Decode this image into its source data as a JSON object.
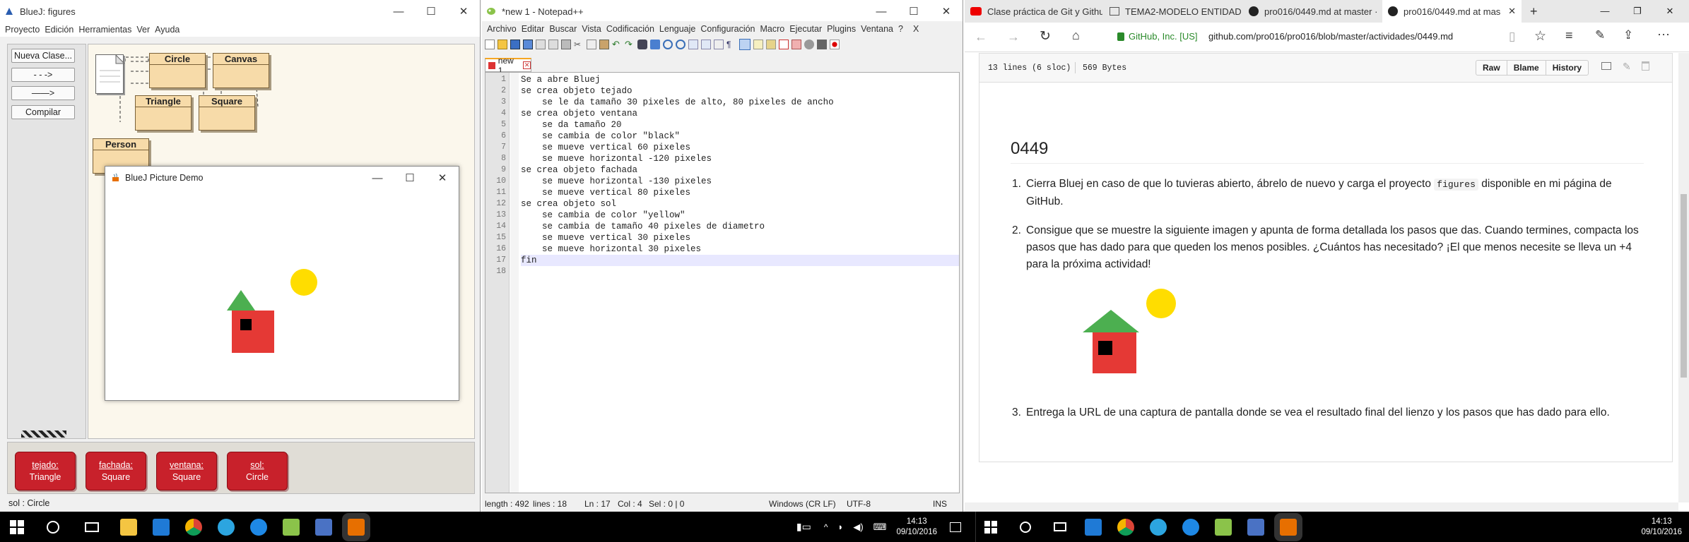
{
  "bluej": {
    "title": "BlueJ:  figures",
    "menu": [
      "Proyecto",
      "Edición",
      "Herramientas",
      "Ver",
      "Ayuda"
    ],
    "buttons": {
      "new_class": "Nueva Clase...",
      "arrow1": "- - ->",
      "arrow2": "——>",
      "compile": "Compilar"
    },
    "classes": [
      "Circle",
      "Canvas",
      "Triangle",
      "Square",
      "Person"
    ],
    "objects": [
      {
        "name": "tejado:",
        "type": "Triangle"
      },
      {
        "name": "fachada:",
        "type": "Square"
      },
      {
        "name": "ventana:",
        "type": "Square"
      },
      {
        "name": "sol:",
        "type": "Circle"
      }
    ],
    "status": "sol : Circle",
    "picture_window_title": "BlueJ Picture Demo"
  },
  "notepad": {
    "title": "*new 1 - Notepad++",
    "menu": [
      "Archivo",
      "Editar",
      "Buscar",
      "Vista",
      "Codificación",
      "Lenguaje",
      "Configuración",
      "Macro",
      "Ejecutar",
      "Plugins",
      "Ventana",
      "?"
    ],
    "menu_close": "X",
    "tab": "new 1",
    "lines": [
      "Se a abre Bluej",
      "se crea objeto tejado",
      "    se le da tamaño 30 pixeles de alto, 80 pixeles de ancho",
      "se crea objeto ventana",
      "    se da tamaño 20",
      "    se cambia de color \"black\"",
      "    se mueve vertical 60 pixeles",
      "    se mueve horizontal -120 pixeles",
      "se crea objeto fachada",
      "    se mueve horizontal -130 pixeles",
      "    se mueve vertical 80 pixeles",
      "se crea objeto sol",
      "    se cambia de color \"yellow\"",
      "    se cambia de tamaño 40 pixeles de diametro",
      "    se mueve vertical 30 pixeles",
      "    se mueve horizontal 30 pixeles",
      "fin",
      ""
    ],
    "line_numbers": [
      "1",
      "2",
      "3",
      "4",
      "5",
      "6",
      "7",
      "8",
      "9",
      "10",
      "11",
      "12",
      "13",
      "14",
      "15",
      "16",
      "17",
      "18"
    ],
    "status": {
      "length": "length : 492",
      "lines": "lines : 18",
      "ln": "Ln : 17",
      "col": "Col : 4",
      "sel": "Sel : 0 | 0",
      "eol": "Windows (CR LF)",
      "enc": "UTF-8",
      "mode": "INS"
    }
  },
  "browser": {
    "tabs": [
      "Clase práctica de Git y Githu",
      "TEMA2-MODELO ENTIDAD",
      "pro016/0449.md at master ·",
      "pro016/0449.md at mas"
    ],
    "cert": "GitHub, Inc. [US]",
    "url": "github.com/pro016/pro016/blob/master/actividades/0449.md",
    "file_info": {
      "lines": "13 lines (6 sloc)",
      "size": "569 Bytes"
    },
    "file_buttons": [
      "Raw",
      "Blame",
      "History"
    ],
    "heading": "0449",
    "items": [
      {
        "before": "Cierra Bluej en caso de que lo tuvieras abierto, ábrelo de nuevo y carga el proyecto ",
        "code": "figures",
        "after": " disponible en mi página de GitHub."
      },
      {
        "text": "Consigue que se muestre la siguiente imagen y apunta de forma detallada los pasos que das. Cuando termines, compacta los pasos que has dado para que queden los menos posibles. ¿Cuántos has necesitado? ¡El que menos necesite se lleva un +4 para la próxima actividad!"
      },
      {
        "text": "Entrega la URL de una captura de pantalla donde se vea el resultado final del lienzo y los pasos que has dado para ello."
      }
    ]
  },
  "taskbar": {
    "left": {
      "time": "14:13",
      "date": "09/10/2016"
    },
    "right": {
      "time": "14:13",
      "date": "09/10/2016"
    }
  },
  "colors": {
    "roof": "#4caf50",
    "wall": "#e53935",
    "window": "#000000",
    "sun": "#ffdd00",
    "object_red": "#c8212b",
    "class_fill": "#f7dba9"
  }
}
